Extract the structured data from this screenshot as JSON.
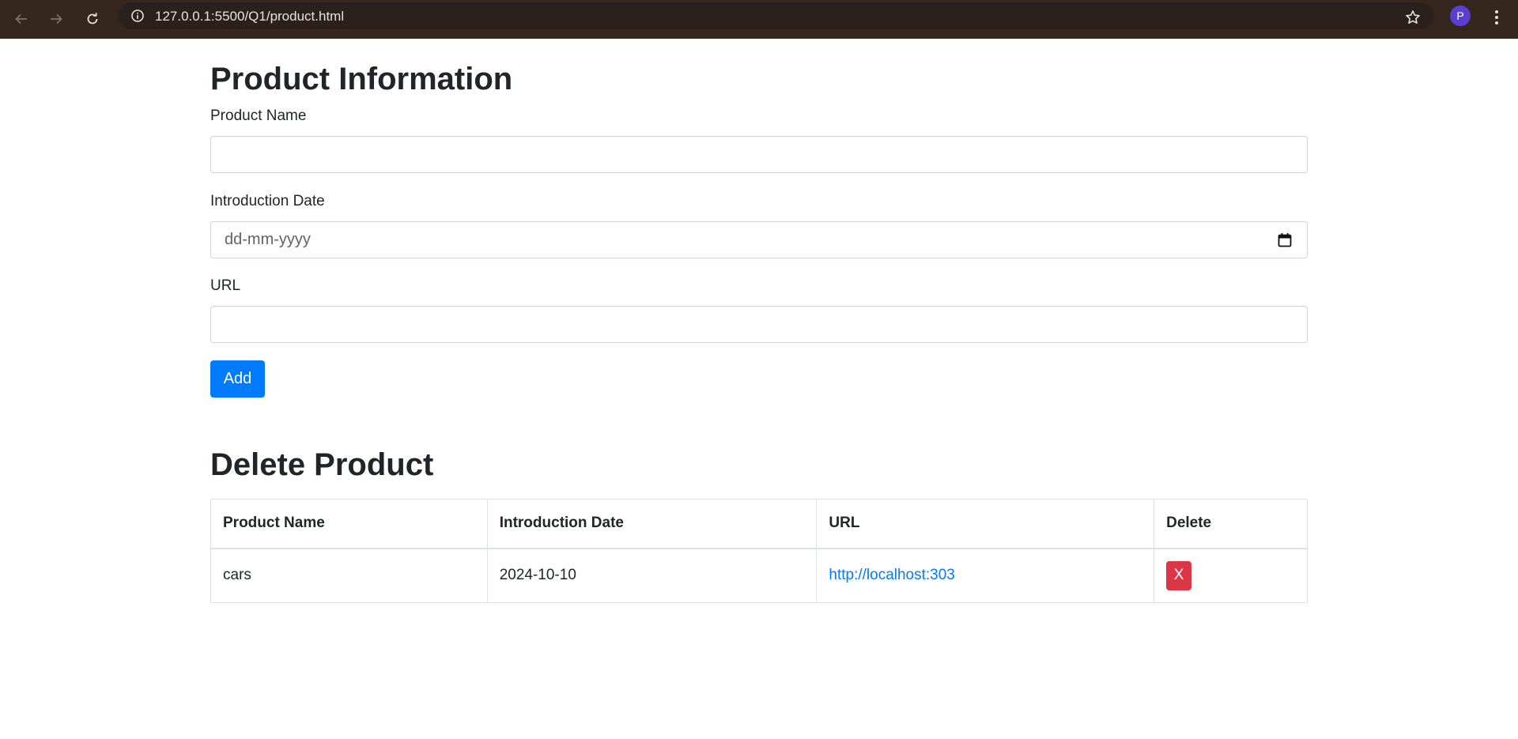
{
  "browser": {
    "url": "127.0.0.1:5500/Q1/product.html",
    "profile_initial": "P"
  },
  "form": {
    "title": "Product Information",
    "product_name_label": "Product Name",
    "product_name_value": "",
    "date_label": "Introduction Date",
    "date_placeholder": "dd-mm-yyyy",
    "url_label": "URL",
    "url_value": "",
    "add_label": "Add"
  },
  "delete_section": {
    "title": "Delete Product",
    "columns": [
      "Product Name",
      "Introduction Date",
      "URL",
      "Delete"
    ],
    "rows": [
      {
        "name": "cars",
        "date": "2024-10-10",
        "url": "http://localhost:303",
        "delete_label": "X"
      }
    ]
  },
  "colors": {
    "primary": "#007bff",
    "danger": "#dc3545",
    "chrome_bar": "#35261e"
  }
}
